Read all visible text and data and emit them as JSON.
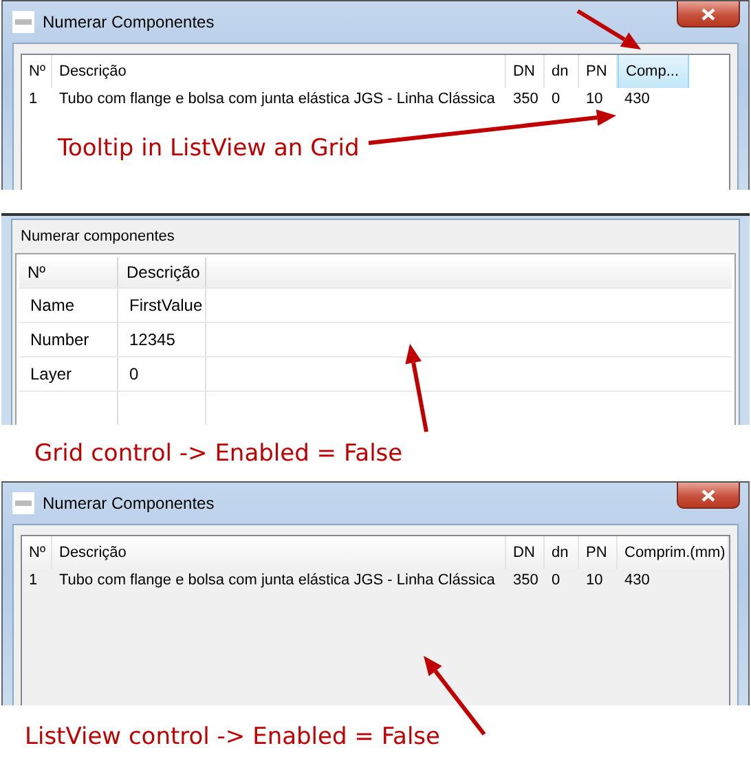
{
  "panels": [
    {
      "kind": "listview",
      "title": "Numerar Componentes",
      "enabled": true,
      "columns": [
        {
          "label": "Nº",
          "hovered": false
        },
        {
          "label": "Descrição",
          "hovered": false
        },
        {
          "label": "DN",
          "hovered": false
        },
        {
          "label": "dn",
          "hovered": false
        },
        {
          "label": "PN",
          "hovered": false
        },
        {
          "label": "Comp...",
          "hovered": true
        }
      ],
      "rows": [
        [
          "1",
          "Tubo com flange e bolsa com junta elástica JGS - Linha Clássica",
          "350",
          "0",
          "10",
          "430"
        ]
      ],
      "annotation": "Tooltip in ListView an Grid"
    },
    {
      "kind": "grid",
      "title": "Numerar componentes",
      "columns": [
        {
          "label": "Nº"
        },
        {
          "label": "Descrição"
        }
      ],
      "rows": [
        [
          "Name",
          "FirstValue"
        ],
        [
          "Number",
          "12345"
        ],
        [
          "Layer",
          "0"
        ]
      ],
      "annotation": "Grid control -> Enabled = False"
    },
    {
      "kind": "listview",
      "title": "Numerar Componentes",
      "enabled": false,
      "columns": [
        {
          "label": "Nº",
          "hovered": false
        },
        {
          "label": "Descrição",
          "hovered": false
        },
        {
          "label": "DN",
          "hovered": false
        },
        {
          "label": "dn",
          "hovered": false
        },
        {
          "label": "PN",
          "hovered": false
        },
        {
          "label": "Comprim.(mm)",
          "hovered": false
        }
      ],
      "rows": [
        [
          "1",
          "Tubo com flange e bolsa com junta elástica JGS - Linha Clássica",
          "350",
          "0",
          "10",
          "430"
        ]
      ],
      "annotation": "ListView control -> Enabled = False"
    }
  ]
}
